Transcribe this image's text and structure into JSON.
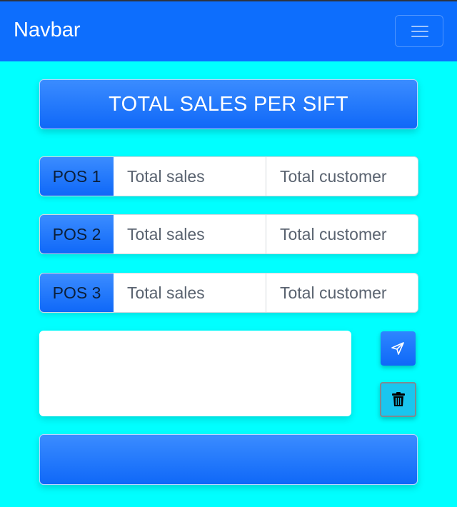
{
  "navbar": {
    "brand": "Navbar",
    "toggle_icon": "hamburger-menu-icon"
  },
  "title_button": {
    "label": "TOTAL SALES PER SIFT"
  },
  "pos_rows": [
    {
      "label": "POS 1",
      "sales_placeholder": "Total sales",
      "customer_placeholder": "Total customer"
    },
    {
      "label": "POS 2",
      "sales_placeholder": "Total sales",
      "customer_placeholder": "Total customer"
    },
    {
      "label": "POS 3",
      "sales_placeholder": "Total sales",
      "customer_placeholder": "Total customer"
    }
  ],
  "actions": {
    "send_icon": "send-icon",
    "delete_icon": "trash-icon"
  },
  "bottom_button": {
    "label": ""
  },
  "colors": {
    "background": "#00ffff",
    "navbar": "#0d6efd",
    "primary": "#0f68f8",
    "info": "#19c6ef"
  }
}
